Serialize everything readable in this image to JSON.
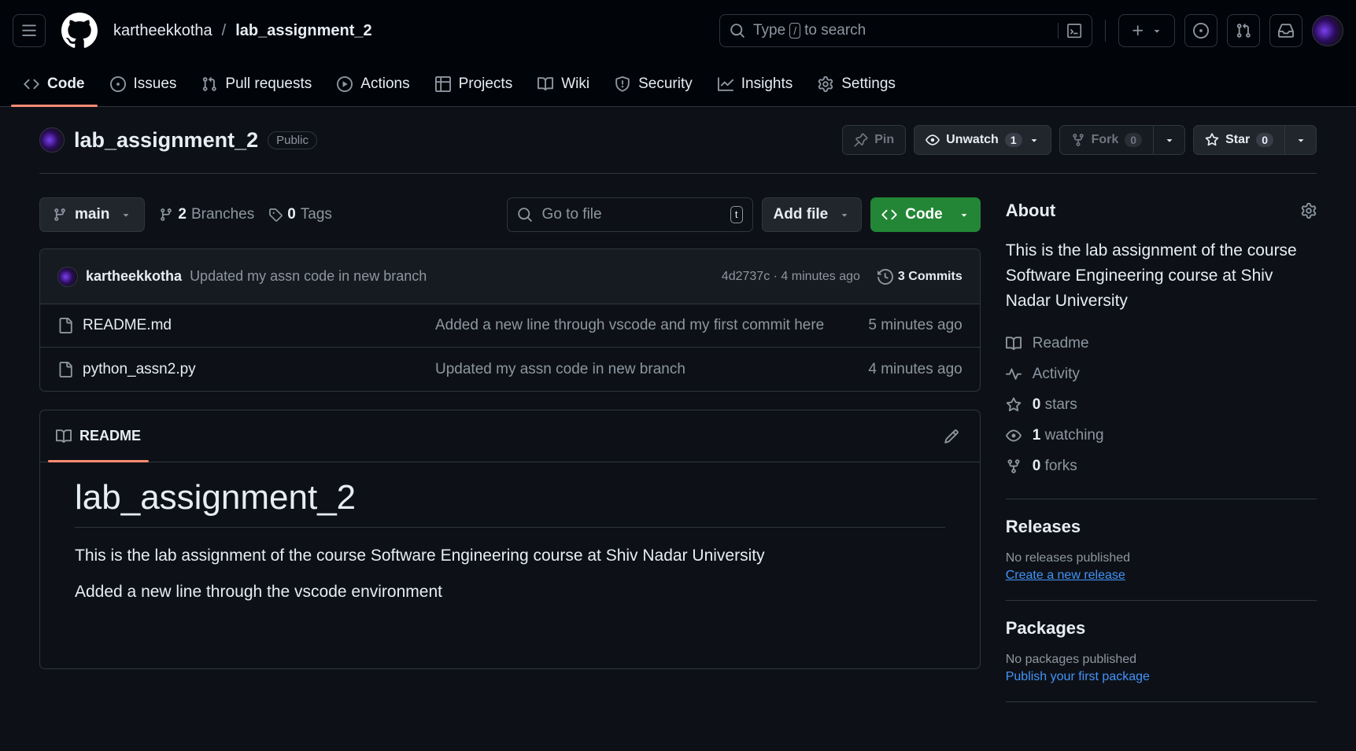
{
  "header": {
    "owner": "kartheekkotha",
    "separator": "/",
    "repo": "lab_assignment_2",
    "search_prefix": "Type",
    "search_key": "/",
    "search_suffix": "to search"
  },
  "tabs": [
    {
      "label": "Code"
    },
    {
      "label": "Issues"
    },
    {
      "label": "Pull requests"
    },
    {
      "label": "Actions"
    },
    {
      "label": "Projects"
    },
    {
      "label": "Wiki"
    },
    {
      "label": "Security"
    },
    {
      "label": "Insights"
    },
    {
      "label": "Settings"
    }
  ],
  "repo": {
    "title": "lab_assignment_2",
    "visibility": "Public",
    "pin_label": "Pin",
    "unwatch_label": "Unwatch",
    "watch_count": "1",
    "fork_label": "Fork",
    "fork_count": "0",
    "star_label": "Star",
    "star_count": "0"
  },
  "filebar": {
    "branch": "main",
    "branches_count": "2",
    "branches_label": "Branches",
    "tags_count": "0",
    "tags_label": "Tags",
    "goto_placeholder": "Go to file",
    "goto_key": "t",
    "add_file": "Add file",
    "code_button": "Code"
  },
  "commit": {
    "author": "kartheekkotha",
    "message": "Updated my assn code in new branch",
    "sha_time": "4d2737c · 4 minutes ago",
    "commits_label": "3 Commits"
  },
  "files": [
    {
      "name": "README.md",
      "message": "Added a new line through vscode and my first commit here",
      "time": "5 minutes ago"
    },
    {
      "name": "python_assn2.py",
      "message": "Updated my assn code in new branch",
      "time": "4 minutes ago"
    }
  ],
  "readme": {
    "tab_label": "README",
    "heading": "lab_assignment_2",
    "para1": "This is the lab assignment of the course Software Engineering course at Shiv Nadar University",
    "para2": "Added a new line through the vscode environment"
  },
  "about": {
    "title": "About",
    "description": "This is the lab assignment of the course Software Engineering course at Shiv Nadar University",
    "readme": "Readme",
    "activity": "Activity",
    "stars_count": "0",
    "stars_label": "stars",
    "watching_count": "1",
    "watching_label": "watching",
    "forks_count": "0",
    "forks_label": "forks"
  },
  "releases": {
    "title": "Releases",
    "note": "No releases published",
    "link": "Create a new release"
  },
  "packages": {
    "title": "Packages",
    "note": "No packages published",
    "link": "Publish your first package"
  },
  "colors": {
    "background": "#0d1117",
    "accent_green": "#238636",
    "link_blue": "#4493f8",
    "tab_underline": "#fd8c73"
  }
}
